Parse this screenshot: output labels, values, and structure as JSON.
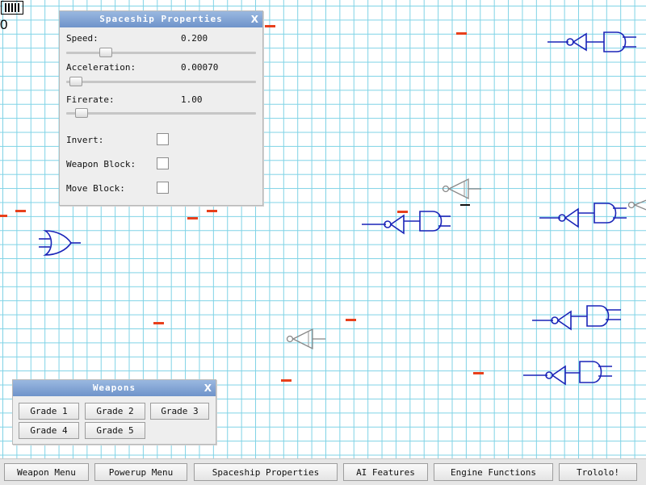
{
  "hud": {
    "score": "0"
  },
  "spaceship_panel": {
    "title": "Spaceship Properties",
    "close": "X",
    "speed": {
      "label": "Speed:",
      "value": "0.200",
      "slider_fraction": 0.21
    },
    "acceleration": {
      "label": "Acceleration:",
      "value": "0.00070",
      "slider_fraction": 0.05
    },
    "firerate": {
      "label": "Firerate:",
      "value": "1.00",
      "slider_fraction": 0.08
    },
    "invert": {
      "label": "Invert:",
      "checked": false
    },
    "weapon_block": {
      "label": "Weapon Block:",
      "checked": false
    },
    "move_block": {
      "label": "Move Block:",
      "checked": false
    }
  },
  "weapons_panel": {
    "title": "Weapons",
    "close": "X",
    "buttons": [
      "Grade 1",
      "Grade 2",
      "Grade 3",
      "Grade 4",
      "Grade 5"
    ]
  },
  "taskbar": {
    "buttons": [
      "Weapon Menu",
      "Powerup Menu",
      "Spaceship Properties",
      "AI Features",
      "Engine Functions",
      "Trololo!"
    ]
  },
  "colors": {
    "grid": "#7fd3e6",
    "enemy": "#1a24b8",
    "projectile": "#e8401c",
    "titlebar": "#7c9dd2",
    "player": "#888888"
  }
}
